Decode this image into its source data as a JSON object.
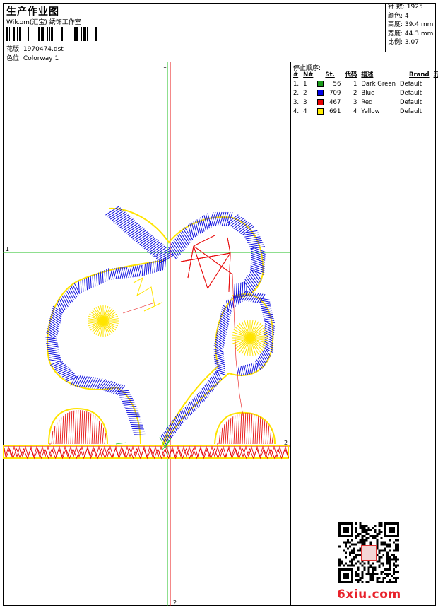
{
  "header": {
    "title": "生产作业图",
    "company": "Wilcom(汇宝) 绣饰工作室",
    "design_label": "花版:",
    "design_file": "1970474.dst",
    "colorway_label": "色位:",
    "colorway": "Colorway 1"
  },
  "stats": [
    {
      "label": "针 数:",
      "value": "1925"
    },
    {
      "label": "颜色:",
      "value": "4"
    },
    {
      "label": "高度:",
      "value": "39.4 mm"
    },
    {
      "label": "宽度:",
      "value": "44.3 mm"
    },
    {
      "label": "比例:",
      "value": "3.07"
    }
  ],
  "stop_sequence": {
    "title": "停止顺序:",
    "headers": [
      "#",
      "N#",
      "St.",
      "代码",
      "描述",
      "Brand",
      "元素"
    ],
    "rows": [
      {
        "idx": "1.",
        "n": "1",
        "color": "#1a9a1a",
        "st": "56",
        "code": "1",
        "desc": "Dark Green",
        "brand": "Default"
      },
      {
        "idx": "2.",
        "n": "2",
        "color": "#0000e6",
        "st": "709",
        "code": "2",
        "desc": "Blue",
        "brand": "Default"
      },
      {
        "idx": "3.",
        "n": "3",
        "color": "#e60000",
        "st": "467",
        "code": "3",
        "desc": "Red",
        "brand": "Default"
      },
      {
        "idx": "4.",
        "n": "4",
        "color": "#ffee00",
        "st": "691",
        "code": "4",
        "desc": "Yellow",
        "brand": "Default"
      }
    ]
  },
  "canvas": {
    "axis_labels": {
      "top": "1",
      "left": "1",
      "right": "2",
      "bottom": "2"
    },
    "thread_colors": {
      "green": "#1fbf1f",
      "blue": "#1010e0",
      "red": "#e81010",
      "yellow": "#ffe400"
    }
  },
  "watermark": "6xiu.com"
}
